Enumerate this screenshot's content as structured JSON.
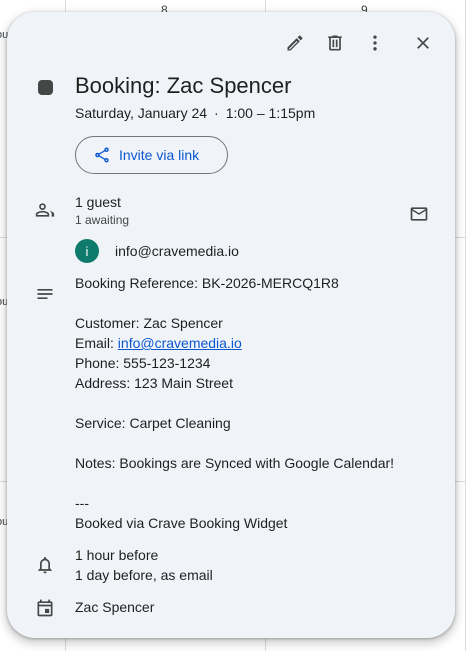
{
  "background": {
    "day_numbers": [
      "8",
      "9"
    ],
    "edge_text": [
      "ou",
      "ou",
      "ou"
    ]
  },
  "toolbar": {
    "edit_icon": "pencil-icon",
    "delete_icon": "trash-icon",
    "more_icon": "more-vert-icon",
    "close_icon": "close-icon"
  },
  "event": {
    "color": "#444746",
    "title": "Booking: Zac Spencer",
    "date": "Saturday, January 24",
    "separator": "·",
    "time": "1:00 – 1:15pm"
  },
  "invite": {
    "label": "Invite via link",
    "icon": "share-icon"
  },
  "guests": {
    "count": "1 guest",
    "status": "1 awaiting",
    "list": [
      {
        "initial": "i",
        "email": "info@cravemedia.io",
        "avatar_color": "#0f7b6c"
      }
    ]
  },
  "description": {
    "reference": "Booking Reference: BK-2026-MERCQ1R8",
    "customer": "Customer: Zac Spencer",
    "email_label": "Email: ",
    "email_link": "info@cravemedia.io",
    "phone": "Phone: 555-123-1234",
    "address": "Address: 123 Main Street",
    "service": "Service: Carpet Cleaning",
    "notes": "Notes: Bookings are Synced with Google Calendar!",
    "divider": "---",
    "footer": "Booked via Crave Booking Widget"
  },
  "reminders": [
    "1 hour before",
    "1 day before, as email"
  ],
  "calendar": {
    "name": "Zac Spencer"
  },
  "colors": {
    "card_bg": "#f0f4f9",
    "link": "#0b57d0",
    "icon": "#444746"
  }
}
